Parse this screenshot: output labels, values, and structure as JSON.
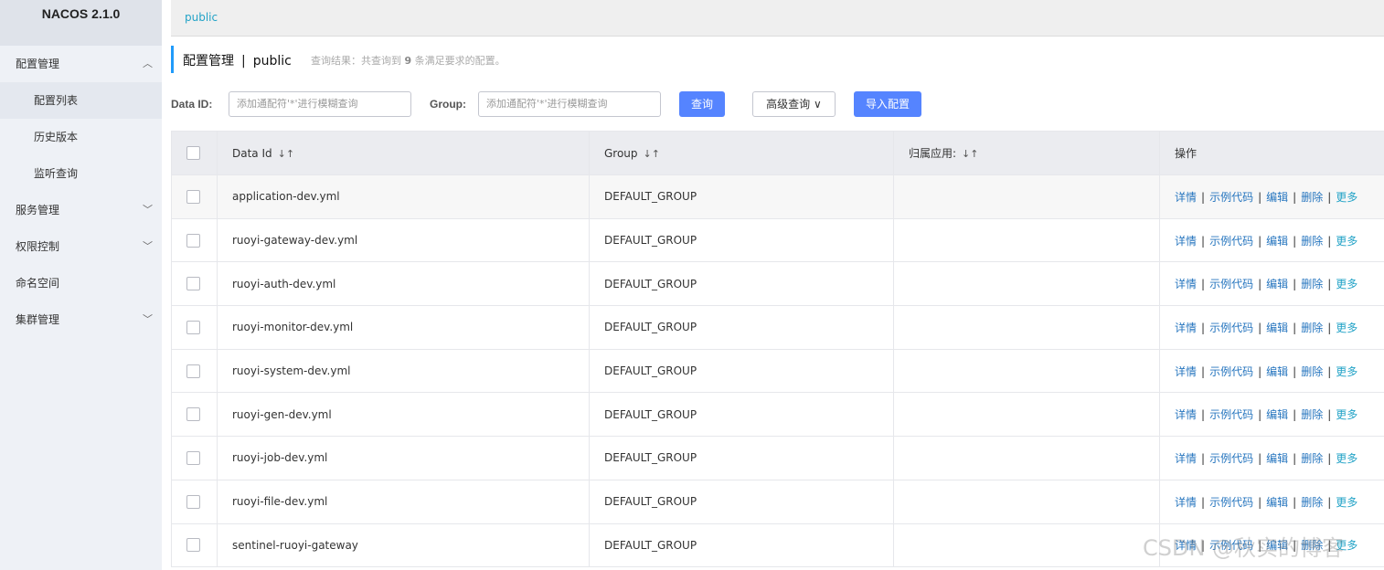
{
  "app": {
    "title": "NACOS 2.1.0"
  },
  "sidebar": {
    "items": [
      {
        "label": "配置管理",
        "chevron": "︿"
      },
      {
        "label": "配置列表"
      },
      {
        "label": "历史版本"
      },
      {
        "label": "监听查询"
      },
      {
        "label": "服务管理",
        "chevron": "﹀"
      },
      {
        "label": "权限控制",
        "chevron": "﹀"
      },
      {
        "label": "命名空间"
      },
      {
        "label": "集群管理",
        "chevron": "﹀"
      }
    ]
  },
  "topbar": {
    "namespace": "public"
  },
  "header": {
    "title": "配置管理",
    "separator": "|",
    "namespace": "public",
    "result_prefix": "查询结果：共查询到",
    "result_count": "9",
    "result_suffix": "条满足要求的配置。"
  },
  "filters": {
    "data_id_label": "Data ID:",
    "data_id_placeholder": "添加通配符'*'进行模糊查询",
    "group_label": "Group:",
    "group_placeholder": "添加通配符'*'进行模糊查询",
    "query_button": "查询",
    "advanced_query_button": "高级查询",
    "import_button": "导入配置"
  },
  "table": {
    "columns": [
      "Data Id",
      "Group",
      "归属应用:",
      "操作"
    ],
    "sort_icon": "↓↑",
    "rows": [
      {
        "data_id": "application-dev.yml",
        "group": "DEFAULT_GROUP",
        "app": ""
      },
      {
        "data_id": "ruoyi-gateway-dev.yml",
        "group": "DEFAULT_GROUP",
        "app": ""
      },
      {
        "data_id": "ruoyi-auth-dev.yml",
        "group": "DEFAULT_GROUP",
        "app": ""
      },
      {
        "data_id": "ruoyi-monitor-dev.yml",
        "group": "DEFAULT_GROUP",
        "app": ""
      },
      {
        "data_id": "ruoyi-system-dev.yml",
        "group": "DEFAULT_GROUP",
        "app": ""
      },
      {
        "data_id": "ruoyi-gen-dev.yml",
        "group": "DEFAULT_GROUP",
        "app": ""
      },
      {
        "data_id": "ruoyi-job-dev.yml",
        "group": "DEFAULT_GROUP",
        "app": ""
      },
      {
        "data_id": "ruoyi-file-dev.yml",
        "group": "DEFAULT_GROUP",
        "app": ""
      },
      {
        "data_id": "sentinel-ruoyi-gateway",
        "group": "DEFAULT_GROUP",
        "app": ""
      }
    ],
    "actions": {
      "detail": "详情",
      "sample": "示例代码",
      "edit": "编辑",
      "delete": "删除",
      "more": "更多",
      "sep": "|"
    }
  },
  "watermark": "CSDN @秋实的博客",
  "colors": {
    "primary": "#5584ff",
    "link": "#2776bf",
    "accent": "#209bfa"
  }
}
